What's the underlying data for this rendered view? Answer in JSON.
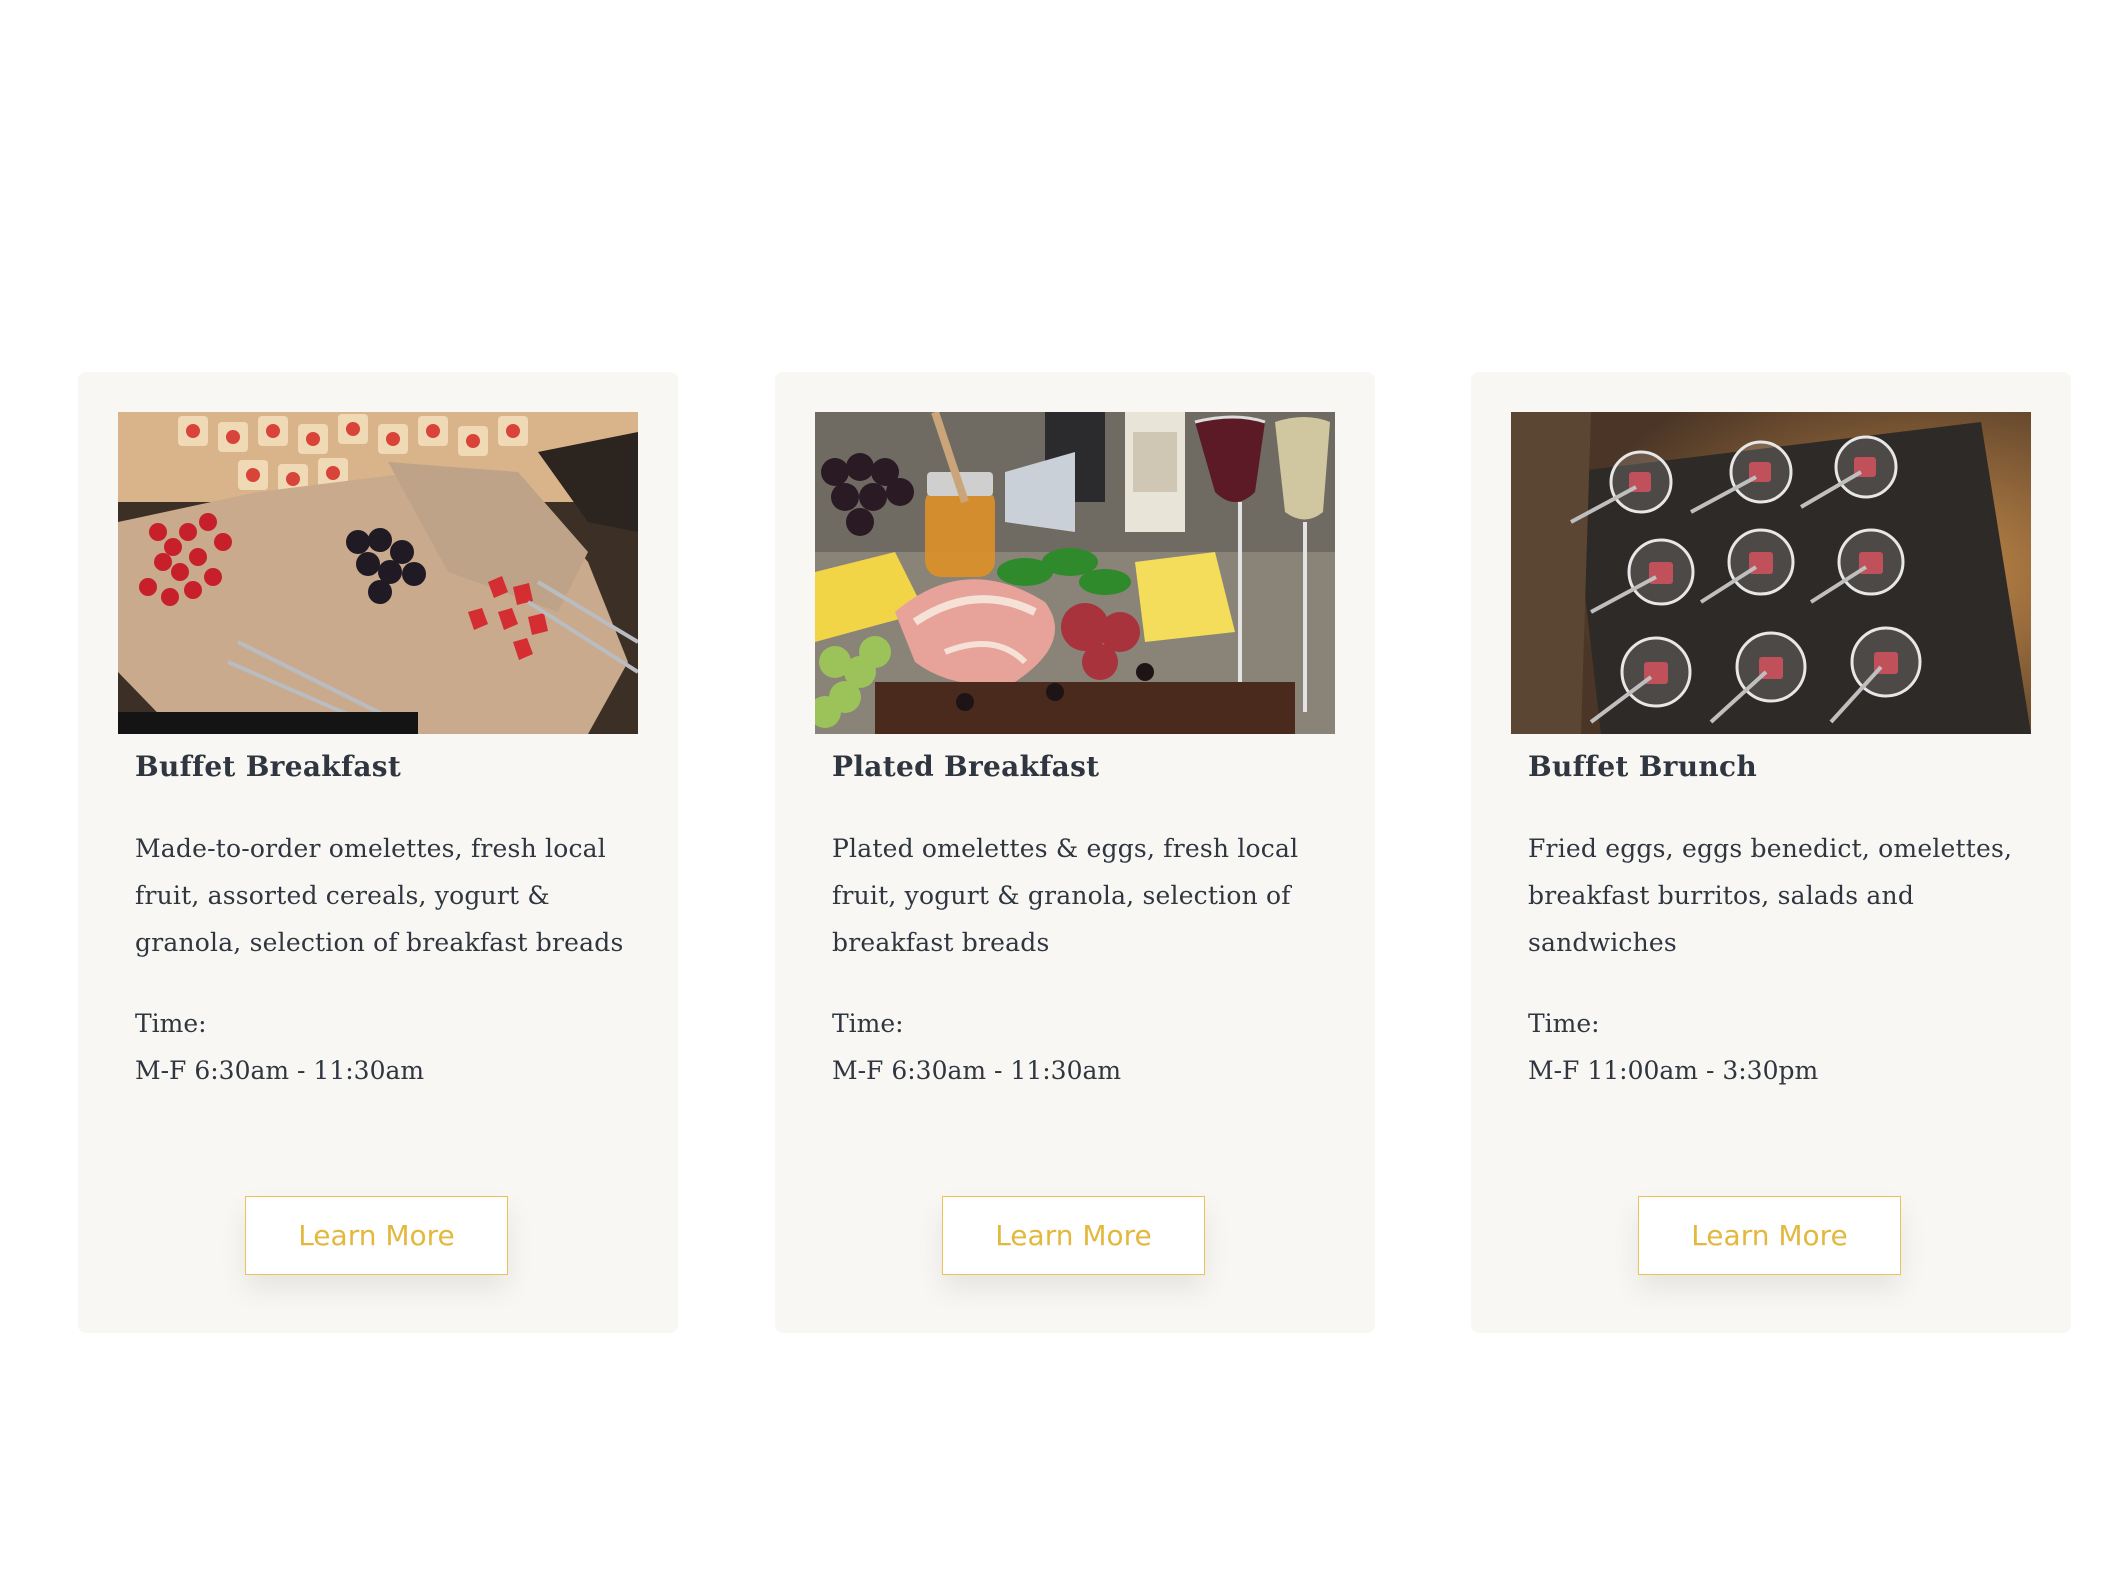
{
  "cards": [
    {
      "image_alt": "Breakfast buffet spread with fruit and pastries",
      "title": "Buffet Breakfast",
      "description": "Made-to-order omelettes, fresh local fruit, assorted cereals, yogurt & granola, selection of breakfast breads",
      "time_label": "Time:",
      "time_value": "M-F 6:30am - 11:30am",
      "button_label": "Learn More"
    },
    {
      "image_alt": "Charcuterie board with cheese, meats, grapes, honey and wine",
      "title": "Plated Breakfast",
      "description": "Plated omelettes & eggs, fresh local fruit, yogurt & granola, selection of breakfast breads",
      "time_label": "Time:",
      "time_value": "M-F 6:30am - 11:30am",
      "button_label": "Learn More"
    },
    {
      "image_alt": "Tray of appetizer cups with forks",
      "title": "Buffet Brunch",
      "description": "Fried eggs, eggs benedict, omelettes, breakfast burritos, salads and sandwiches",
      "time_label": "Time:",
      "time_value": "M-F 11:00am - 3:30pm",
      "button_label": "Learn More"
    }
  ],
  "colors": {
    "card_background": "#f8f7f4",
    "text": "#2f3640",
    "accent": "#e3b83e"
  }
}
